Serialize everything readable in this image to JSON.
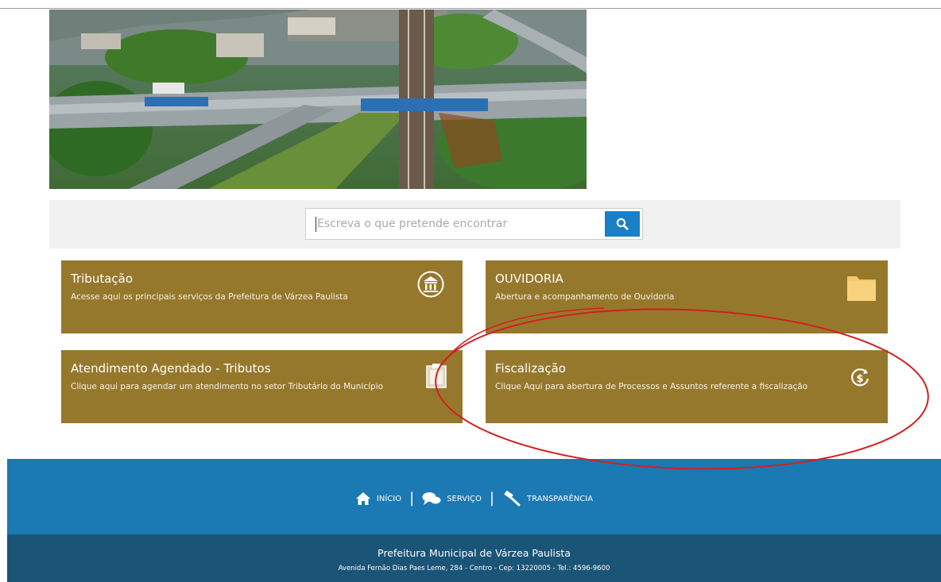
{
  "search": {
    "placeholder": "Escreva o que pretende encontrar"
  },
  "cards": [
    {
      "title": "Tributação",
      "description": "Acesse aqui os principais serviços da Prefeitura de Várzea Paulista",
      "icon": "bank-icon"
    },
    {
      "title": "OUVIDORIA",
      "description": "Abertura e acompanhamento de Ouvidoria",
      "icon": "folder-icon"
    },
    {
      "title": "Atendimento Agendado - Tributos",
      "description": "Clique aqui para agendar um atendimento no setor Tributário do Município",
      "icon": "clipboard-icon"
    },
    {
      "title": "Fiscalização",
      "description": "Clique Aqui para abertura de Processos e Assuntos referente a fiscalização",
      "icon": "dollar-circle-icon"
    }
  ],
  "nav": {
    "home": "INÍCIO",
    "services": "SERVIÇO",
    "transparency": "TRANSPARÊNCIA",
    "separator": "|"
  },
  "footer": {
    "org": "Prefeitura Municipal de Várzea Paulista",
    "address": "Avenida Fernão Dias Paes Leme, 284 - Centro - Cep: 13220005 - Tel.: 4596-9600"
  },
  "colors": {
    "card": "#96782d",
    "footer": "#1b79b3",
    "footer_bottom": "#1a5477",
    "search_button": "#1a7fc4",
    "annotation": "#d21f1f"
  }
}
